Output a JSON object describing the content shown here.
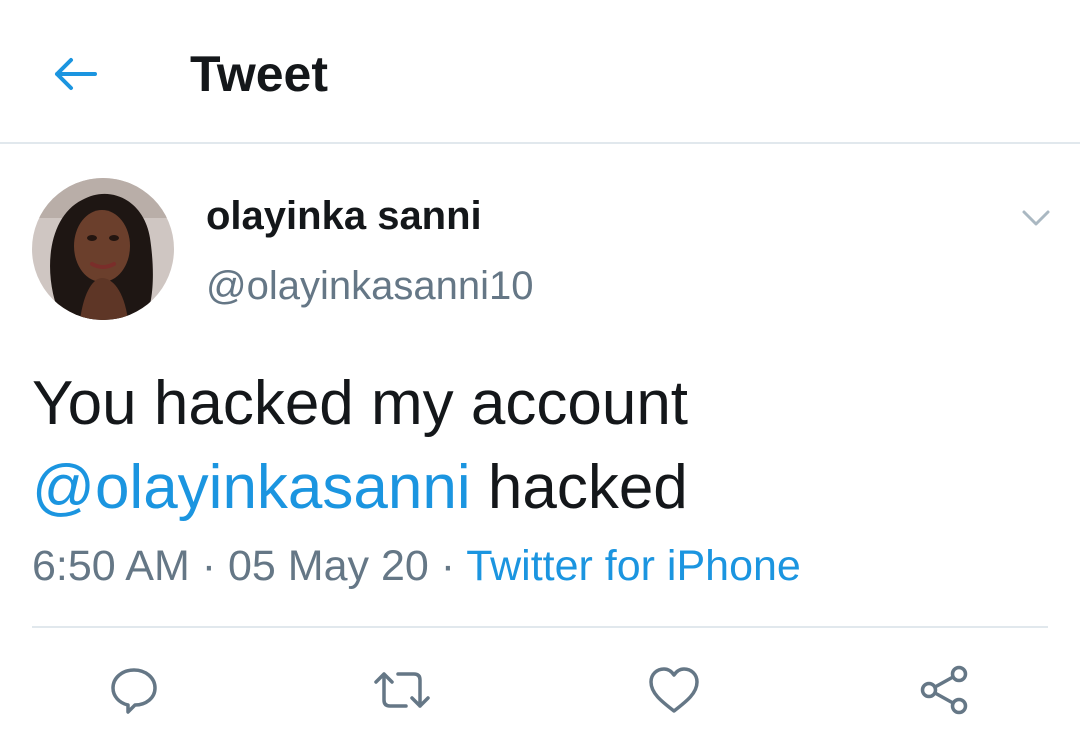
{
  "header": {
    "title": "Tweet",
    "back_icon": "arrow-left-icon"
  },
  "tweet": {
    "author": {
      "name": "olayinka sanni",
      "handle": "@olayinkasanni10"
    },
    "text_plain": "You hacked my account",
    "mention": "@olayinkasanni",
    "text_after_mention": " hacked",
    "time": "6:50 AM",
    "separator1": " · ",
    "date": "05 May 20",
    "separator2": " · ",
    "source": "Twitter for iPhone"
  },
  "actions": [
    {
      "icon": "reply-icon"
    },
    {
      "icon": "retweet-icon"
    },
    {
      "icon": "like-icon"
    },
    {
      "icon": "share-icon"
    }
  ],
  "colors": {
    "accent": "#1b95e0",
    "text": "#14171a",
    "secondary": "#657786",
    "divider": "#e1e8ed"
  }
}
